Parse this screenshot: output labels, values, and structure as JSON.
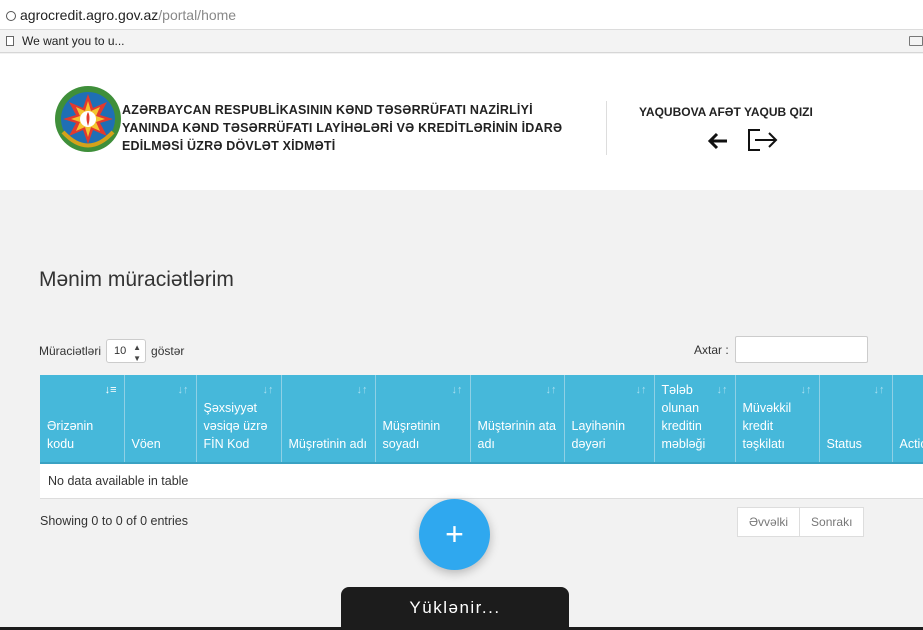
{
  "browser": {
    "url_domain": "agrocredit.agro.gov.az",
    "url_path": "/portal/home",
    "bookmark_label": "We want you to u..."
  },
  "header": {
    "org_name": "AZƏRBAYCAN RESPUBLİKASININ KƏND TƏSƏRRÜFATI NAZİRLİYİ YANINDA KƏND TƏSƏRRÜFATI LAYİHƏLƏRİ VƏ KREDİTLƏRİNİN İDARƏ EDİLMƏSİ ÜZRƏ DÖVLƏT XİDMƏTİ",
    "user_name": "YAQUBOVA AFƏT YAQUB QIZI",
    "back_icon": "arrow-left-icon",
    "logout_icon": "logout-icon"
  },
  "main": {
    "title": "Mənim müraciətlərim",
    "length_prefix": "Müraciətləri",
    "length_value": "10",
    "length_suffix": "göstər",
    "search_label": "Axtar :",
    "columns": [
      "Ərizənin kodu",
      "Vöen",
      "Şəxsiyyət vəsiqə üzrə FİN Kod",
      "Müşrətinin adı",
      "Müşrətinin soyadı",
      "Müştərinin ata adı",
      "Layihənin dəyəri",
      "Tələb olunan kreditin məbləği",
      "Müvəkkil kredit təşkilatı",
      "Status",
      "Action"
    ],
    "empty_text": "No data available in table",
    "info_text": "Showing 0 to 0 of 0 entries",
    "prev_label": "Əvvəlki",
    "next_label": "Sonrakı",
    "add_label": "+",
    "loading_text": "Yüklənir..."
  },
  "colors": {
    "table_header": "#46b8da",
    "fab": "#2fa8ef"
  }
}
